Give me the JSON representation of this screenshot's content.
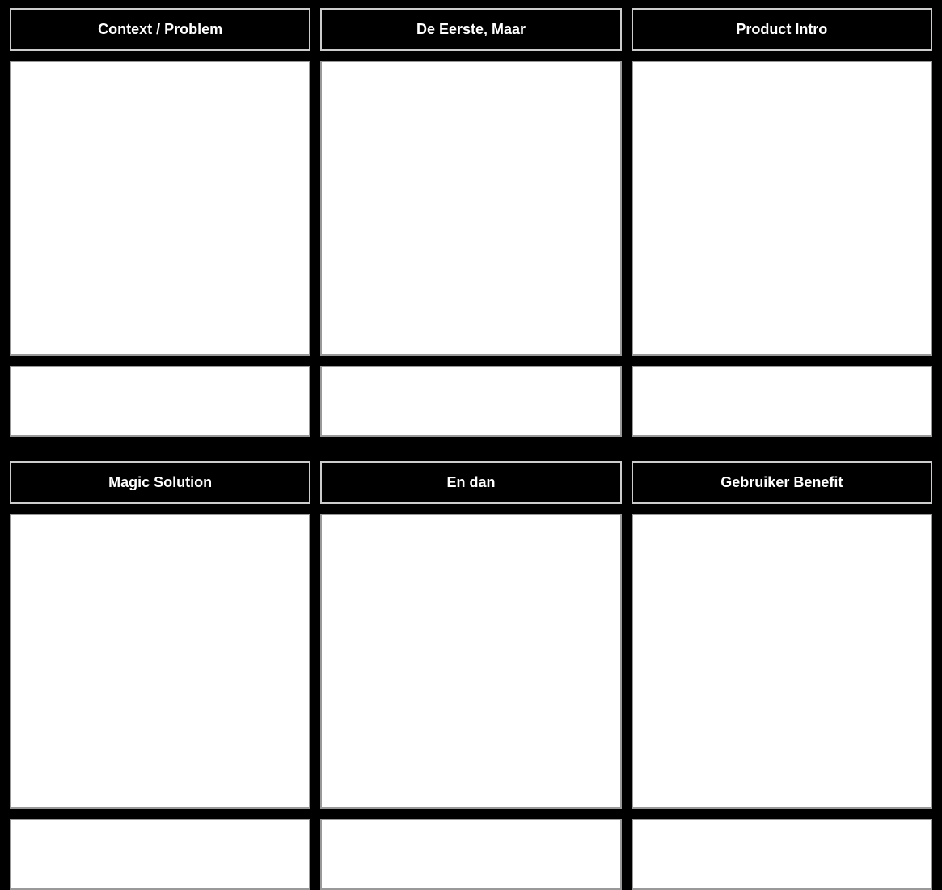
{
  "storyboard": {
    "rows": [
      {
        "cells": [
          {
            "title": "Context / Problem"
          },
          {
            "title": "De Eerste, Maar"
          },
          {
            "title": "Product Intro"
          }
        ]
      },
      {
        "cells": [
          {
            "title": "Magic Solution"
          },
          {
            "title": "En dan"
          },
          {
            "title": "Gebruiker Benefit"
          }
        ]
      }
    ]
  }
}
